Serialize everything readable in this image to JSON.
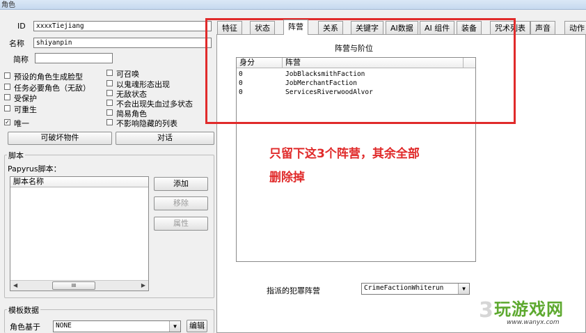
{
  "window": {
    "title": "角色"
  },
  "form": {
    "id_label": "ID",
    "id_value": "xxxxTiejiang",
    "name_label": "名称",
    "name_value": "shiyanpin",
    "short_label": "简称",
    "short_value": ""
  },
  "flags_left": [
    {
      "label": "预设的角色生成脸型",
      "checked": false
    },
    {
      "label": "任务必要角色（无敌）",
      "checked": false
    },
    {
      "label": "受保护",
      "checked": false
    },
    {
      "label": "可重生",
      "checked": false
    },
    {
      "label": "唯一",
      "checked": true
    }
  ],
  "flags_right": [
    {
      "label": "可召唤",
      "checked": false
    },
    {
      "label": "以鬼魂形态出现",
      "checked": false
    },
    {
      "label": "无敌状态",
      "checked": false
    },
    {
      "label": "不会出现失血过多状态",
      "checked": false
    },
    {
      "label": "简易角色",
      "checked": false
    },
    {
      "label": "不影响隐藏的列表",
      "checked": false
    }
  ],
  "buttons": {
    "destructible": "可破坏物件",
    "dialogue": "对话",
    "add": "添加",
    "remove": "移除",
    "properties": "属性",
    "edit": "编辑"
  },
  "scripts": {
    "group_title": "脚本",
    "papyrus_label": "Papyrus脚本：",
    "column_name": "脚本名称",
    "scroll_thumb": "III"
  },
  "template": {
    "group_title": "模板数据",
    "based_on_label": "角色基于",
    "based_on_value": "NONE"
  },
  "tabs": [
    {
      "label": "特征",
      "active": false
    },
    {
      "label": "状态",
      "active": false
    },
    {
      "label": "阵营",
      "active": true
    },
    {
      "label": "关系",
      "active": false
    },
    {
      "label": "关键字",
      "active": false
    },
    {
      "label": "AI数据",
      "active": false
    },
    {
      "label": "AI 组件",
      "active": false
    },
    {
      "label": "装备",
      "active": false
    },
    {
      "label": "咒术列表",
      "active": false
    },
    {
      "label": "声音",
      "active": false
    },
    {
      "label": "动作",
      "active": false
    }
  ],
  "faction_panel": {
    "title": "阵营与阶位",
    "columns": [
      "身分",
      "阵营"
    ],
    "rows": [
      {
        "rank": "0",
        "faction": "JobBlacksmithFaction"
      },
      {
        "rank": "0",
        "faction": "JobMerchantFaction"
      },
      {
        "rank": "0",
        "faction": "ServicesRiverwoodAlvor"
      }
    ],
    "crime_label": "指派的犯罪阵营",
    "crime_value": "CrimeFactionWhiterun"
  },
  "annotation": {
    "line1": "只留下这3个阵营，其余全部",
    "line2": "删除掉"
  },
  "watermark": {
    "site_name": "玩游戏网",
    "site_url": "www.wanyx.com",
    "digit": "3"
  },
  "colors": {
    "annotation_red": "#e02a2a",
    "watermark_green": "#5da92f"
  }
}
